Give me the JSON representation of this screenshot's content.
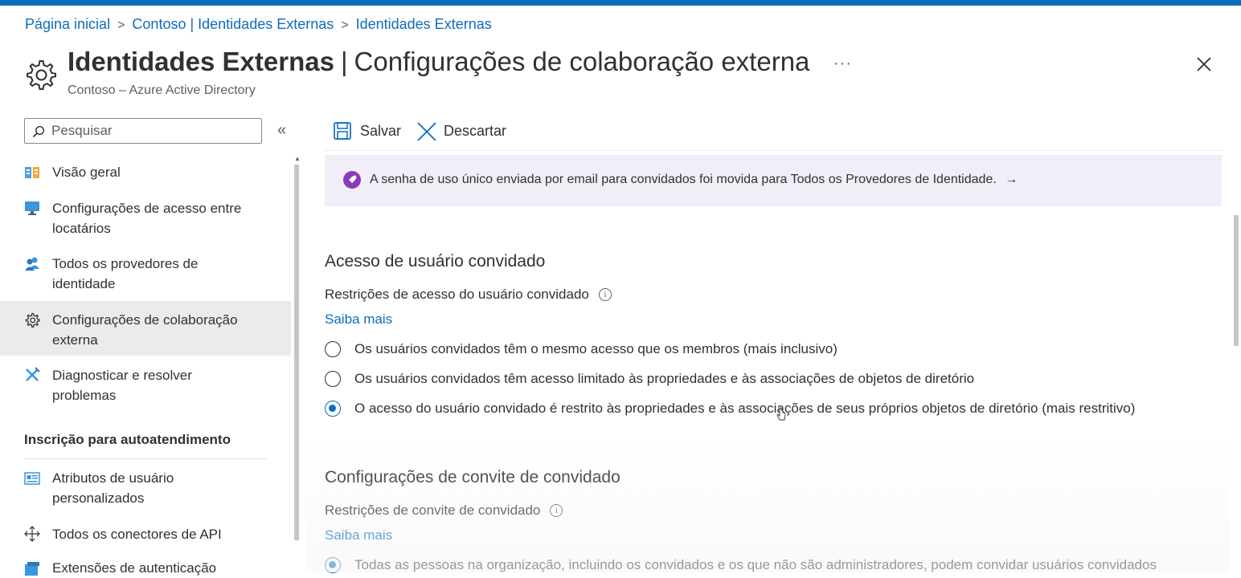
{
  "breadcrumb": {
    "items": [
      "Página inicial",
      "Contoso | Identidades Externas",
      "Identidades Externas"
    ],
    "separator": ">"
  },
  "header": {
    "title_bold": "Identidades Externas",
    "title_separator": "|",
    "title_rest": "Configurações de colaboração externa",
    "more": "···",
    "subtitle": "Contoso – Azure Active Directory",
    "icon": "gear-icon",
    "close_icon": "close-icon"
  },
  "search": {
    "placeholder": "Pesquisar",
    "value": "",
    "collapse": "«"
  },
  "sidebar": {
    "items": [
      {
        "label_line1": "Visão geral",
        "label_line2": "",
        "icon": "overview-icon",
        "selected": false
      },
      {
        "label_line1": "Configurações de acesso entre",
        "label_line2": "locatários",
        "icon": "monitor-icon",
        "selected": false
      },
      {
        "label_line1": "Todos os provedores de",
        "label_line2": "identidade",
        "icon": "users-icon",
        "selected": false
      },
      {
        "label_line1": "Configurações de colaboração",
        "label_line2": "externa",
        "icon": "gear-icon",
        "selected": true
      },
      {
        "label_line1": "Diagnosticar e resolver",
        "label_line2": "problemas",
        "icon": "wrench-icon",
        "selected": false
      }
    ],
    "section_title": "Inscrição para autoatendimento",
    "section_items": [
      {
        "label_line1": "Atributos de usuário",
        "label_line2": "personalizados",
        "icon": "id-card-icon"
      },
      {
        "label_line1": "Todos os conectores de API",
        "label_line2": "",
        "icon": "api-connector-icon"
      },
      {
        "label_line1": "Extensões de autenticação",
        "label_line2": "",
        "icon": "extension-icon"
      }
    ]
  },
  "toolbar": {
    "save_label": "Salvar",
    "discard_label": "Descartar"
  },
  "banner": {
    "text": "A senha de uso único enviada por email para convidados foi movida para Todos os Provedores de Identidade.",
    "arrow": "→",
    "icon": "rocket-icon"
  },
  "guest_access": {
    "heading": "Acesso de usuário convidado",
    "label": "Restrições de acesso do usuário convidado",
    "info": "i",
    "learn_more": "Saiba mais",
    "options": [
      {
        "label": "Os usuários convidados têm o mesmo acesso que os membros (mais inclusivo)",
        "checked": false
      },
      {
        "label": "Os usuários convidados têm acesso limitado às propriedades e às associações de objetos de diretório",
        "checked": false
      },
      {
        "label": "O acesso do usuário convidado é restrito às propriedades e às associações de seus próprios objetos de diretório (mais restritivo)",
        "checked": true
      }
    ]
  },
  "guest_invite": {
    "heading": "Configurações de convite de convidado",
    "label": "Restrições de convite de convidado",
    "info": "i",
    "learn_more": "Saiba mais",
    "options": [
      {
        "label": "Todas as pessoas na organização, incluindo os convidados e os que não são administradores, podem convidar usuários convidados",
        "checked": true
      }
    ]
  },
  "colors": {
    "accent": "#0f6cbd",
    "selected_bg": "#edebe9",
    "banner_bg": "#f1eef8",
    "banner_icon": "#8a3ab9"
  }
}
